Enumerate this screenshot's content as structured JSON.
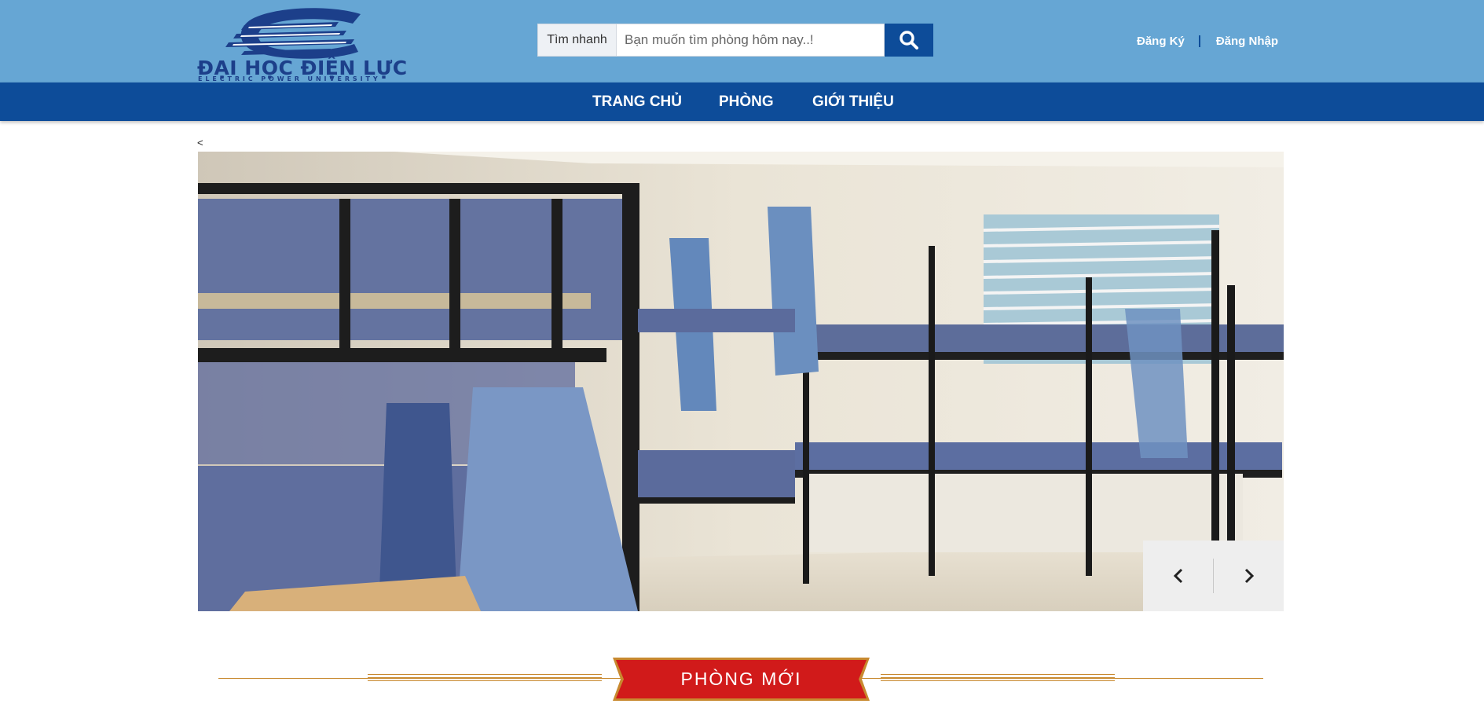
{
  "brand": {
    "logo_text": "ĐẠI HỌC ĐIỆN LỰC",
    "logo_subtext": "ELECTRIC POWER UNIVERSITY",
    "colors": {
      "header_bg": "#66a6d4",
      "nav_bg": "#0d4c99",
      "logo_blue": "#1c3f8a",
      "ribbon_red": "#d11a1a",
      "accent_gold": "#c8892f"
    }
  },
  "search": {
    "label": "Tìm nhanh",
    "placeholder": "Bạn muốn tìm phòng hôm nay..!",
    "value": "",
    "button_icon": "search-icon"
  },
  "auth": {
    "register": "Đăng Ký",
    "login": "Đăng Nhập"
  },
  "nav": {
    "items": [
      {
        "label": "TRANG CHỦ"
      },
      {
        "label": "PHÒNG"
      },
      {
        "label": "GIỚI THIỆU"
      }
    ]
  },
  "slider": {
    "prev_text": "<",
    "image_alt": "dormitory room with bunk beds",
    "prev_icon": "chevron-left-icon",
    "next_icon": "chevron-right-icon"
  },
  "section": {
    "title": "PHÒNG MỚI"
  }
}
